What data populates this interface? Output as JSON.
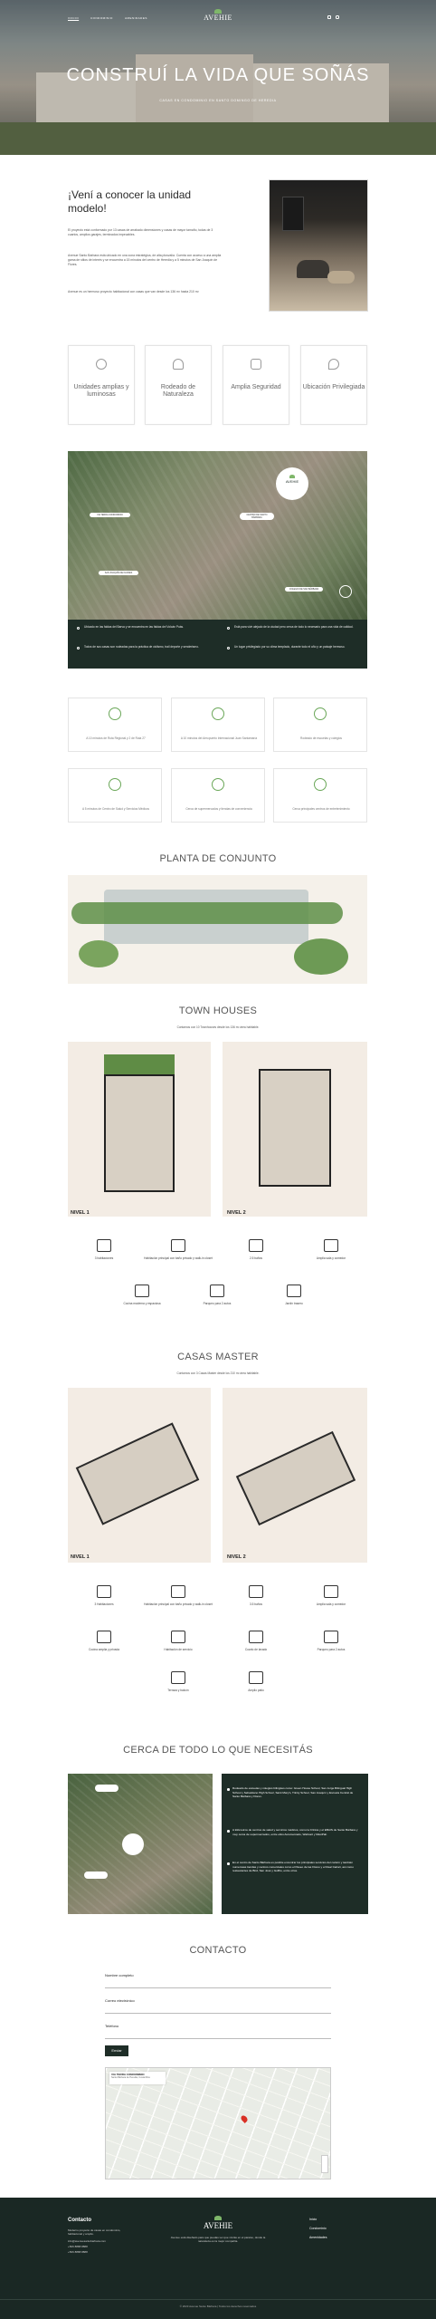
{
  "nav": {
    "items": [
      "INICIO",
      "CONDOMINIO",
      "AMENIDADES"
    ],
    "logo": "AVEHIE"
  },
  "hero": {
    "title": "CONSTRUÍ LA VIDA QUE SOÑÁS",
    "subtitle": "CASAS EN CONDOMINIO EN SANTO DOMINGO DE HEREDIA"
  },
  "intro": {
    "title": "¡Vení a conocer la unidad modelo!",
    "p1": "El proyecto está conformado por 13 casas de arrabado dimensiones y casas de mayor tamaño, todas de 3 cuartos, amplios garajes, terminados impecables.",
    "p2": "Avenue Santo Bárbara está ubicado en una zona estratégica, de alta plusvalía. Cuenta con acceso a una amplia gama de sitios de interés y se encuentra a 15 minutos del centro de Heredia y a 5 minutos de San Joaquín de Flores.",
    "p3": "Avenue es un hermoso proyecto habitacional con casas que van desde los 136 m² hasta 210 m²"
  },
  "features": [
    {
      "label": "Unidades amplias y luminosas",
      "icon": "sun-icon"
    },
    {
      "label": "Rodeado de Naturaleza",
      "icon": "tree-icon"
    },
    {
      "label": "Amplia Seguridad",
      "icon": "grid-icon"
    },
    {
      "label": "Ubicación Privilegiada",
      "icon": "pin-icon"
    }
  ],
  "map": {
    "pins": [
      "VIA TERRA CONDOMINIO",
      "CENTRO DE SANTO BÁRBARA",
      "SAN JOAQUÍN DE FLORES",
      "COLEGIO DE SAN BÁRBARA"
    ],
    "logo": "AVEHIE"
  },
  "location_points": [
    "Ubicado en las faldas del Barva y se encuentra en las faldas del Volcán Poás.",
    "Todos de sus casas son rodeadas para la práctica de ciclismo, trail deporte y senderismo.",
    "Está para vivir alejado de la ciudad pero cerca de todo lo necesario para una vida de calidad.",
    "Un lugar privilegiado por su clima templado, durante todo el año y un paisaje hermoso."
  ],
  "amenities": [
    "A 10 minutos de Ruta Regional y 2 de Ruta 27",
    "A 10 minutos del Aeropuerto Internacional Juan Santamaría",
    "Rodeado de escuelas y colegios",
    "A 5 minutos de Centro de Salud y Servicios Médicos",
    "Cerca de supermercados y tiendas de conveniencia",
    "Cerca principales centros de entretenimiento"
  ],
  "planta": {
    "title": "PLANTA DE CONJUNTO"
  },
  "townhouses": {
    "title": "TOWN HOUSES",
    "subtitle": "Contamos con 10 Townhouses desde los 136 m² área habitable.",
    "level1": "NIVEL 1",
    "level2": "NIVEL 2",
    "features": [
      "3 habitaciones",
      "Habitación principal con baño privado y walk-in closet",
      "2.5 baños",
      "Amplia sala y comedor",
      "Cocina moderna y espaciosa",
      "Parqueo para 2 autos",
      "Jardín trasero"
    ]
  },
  "master": {
    "title": "CASAS MASTER",
    "subtitle": "Contamos con 3 Casas Master desde los 210 m² área habitable.",
    "level1": "NIVEL 1",
    "level2": "NIVEL 2",
    "features": [
      "3 Habitaciones",
      "Habitación principal con baño privado y walk-in closet",
      "3.5 baños",
      "Amplia sala y comedor",
      "Cocina amplia y privada",
      "Habitación de servicio",
      "Cuarto de lavado",
      "Parqueo para 2 autos",
      "Terraza y balcón",
      "Amplio patio"
    ]
  },
  "cerca": {
    "title": "CERCA DE TODO LO QUE NECESITÁS",
    "items": [
      "Rodeado de escuelas y colegios bilingües como: Green House School, San Jorge Bilingual High School y Sebastiano High School, Saint Mary's, Trinity School, San Joaquín y Escuela Central de Santo Bárbara y Flores.",
      "A kilómetros de centros de salud y servicios médicos, como la Clínica y el EBAIS de Santo Bárbara y muy cerca de supermercados, entre ellos Automercado, Walmart y MaxiPali.",
      "En el centro de Santo Bárbara es posible encontrar los principales servicios del cantón y también numerosas tiendas y centros comerciales como el Paseo de las Flores y el Real Cariari, así como restaurantes de Bird, San José y Golfito, entre otros."
    ]
  },
  "contact": {
    "title": "CONTACTO",
    "name_label": "Nombre completo",
    "email_label": "Correo electrónico",
    "phone_label": "Teléfono",
    "send": "Enviar",
    "map_title": "VIA TERRA CONDOMINIO",
    "map_addr": "Santo Bárbara de Heredia, Costa Rica"
  },
  "footer": {
    "heading": "Contacto",
    "logo": "AVEHIE",
    "lines": [
      "Moderno proyecto de casas en condominio, habitacional y amplio.",
      "info@avenuesantobarbara.com",
      "+506 8888 8888",
      "+506 8888 8888"
    ],
    "tagline": "Avenue está diseñado para que puedas ver que vivirás en el paraíso, donde la naturaleza es la mejor compañía.",
    "links": [
      "Inicio",
      "Condominio",
      "Amenidades"
    ],
    "copyright": "© 2023 Avenue Santo Bárbara | Todos los derechos reservados"
  }
}
